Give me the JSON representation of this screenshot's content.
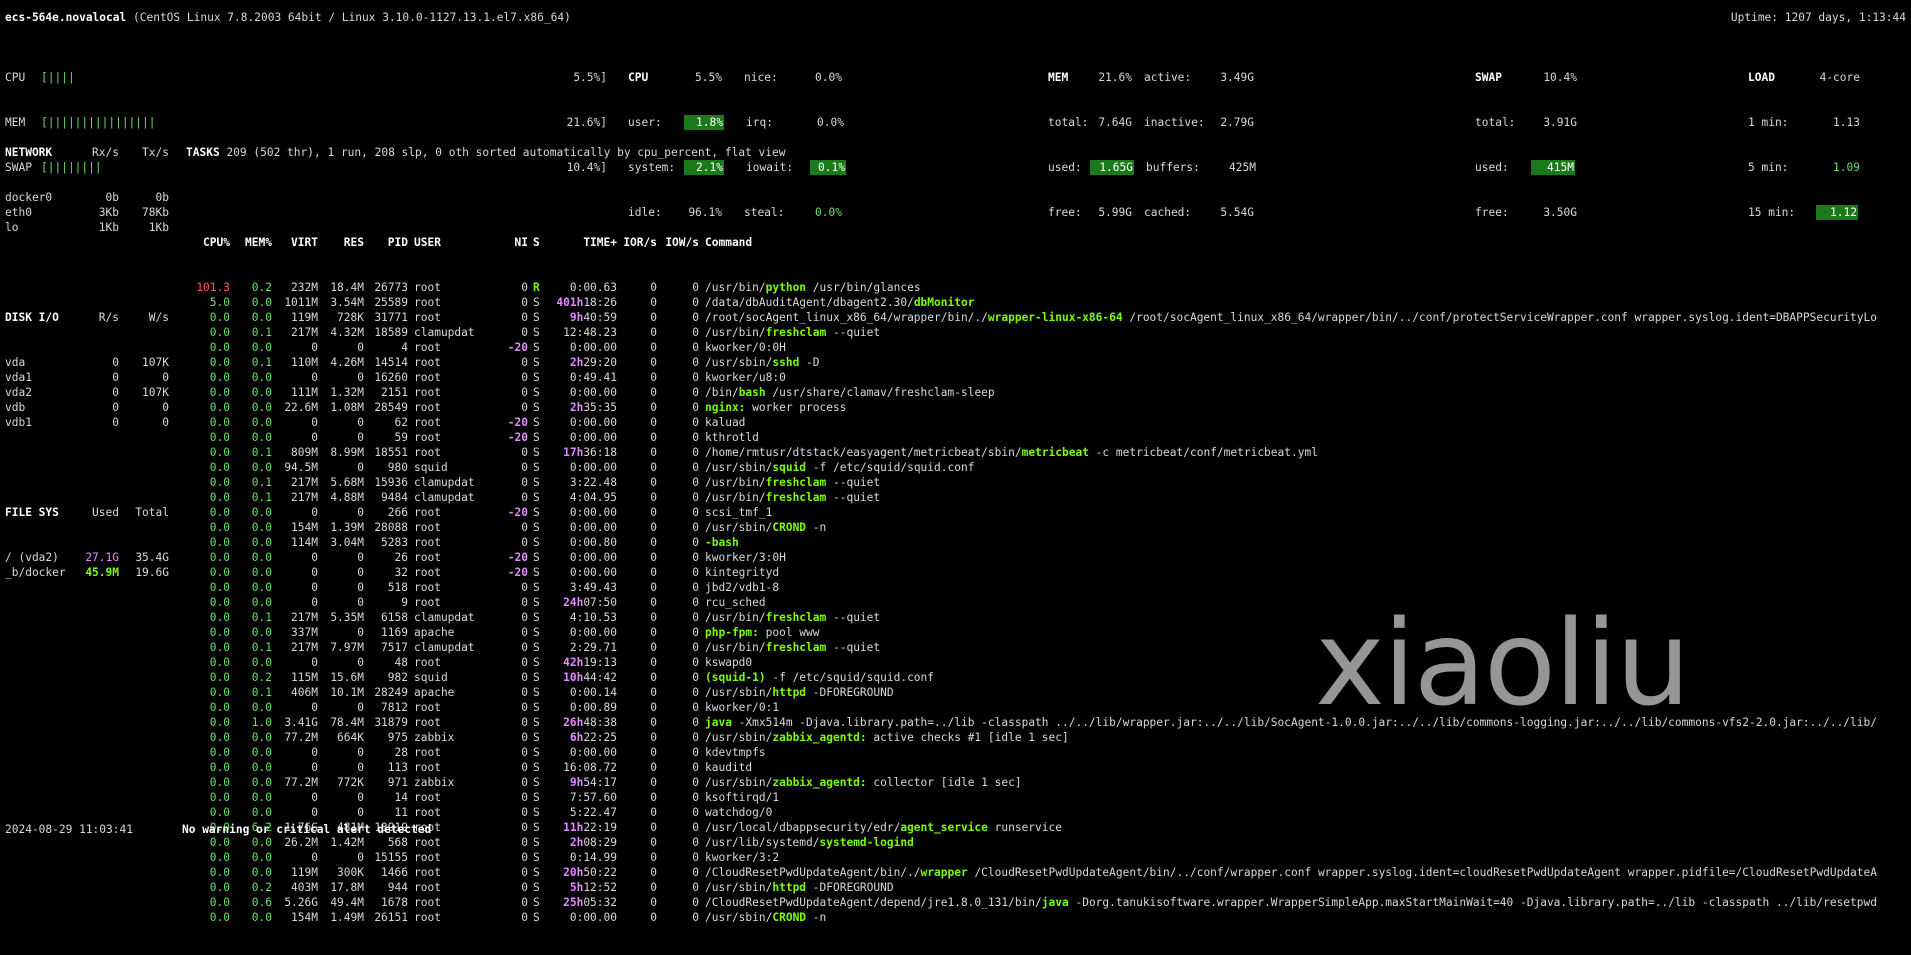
{
  "header": {
    "hostname": "ecs-564e.novalocal",
    "sysinfo": "(CentOS Linux 7.8.2003 64bit / Linux 3.10.0-1127.13.1.el7.x86_64)",
    "uptime": "Uptime: 1207 days, 1:13:44"
  },
  "quicklook": {
    "cpu_label": "CPU",
    "cpu_bar": "[||||",
    "cpu_pct": "5.5%]",
    "mem_label": "MEM",
    "mem_bar": "[||||||||||||||||",
    "mem_pct": "21.6%]",
    "swap_label": "SWAP",
    "swap_bar": "[||||||||",
    "swap_pct": "10.4%]"
  },
  "cpu": {
    "title": "CPU",
    "total": "5.5%",
    "user_label": "user:",
    "user": "1.8%",
    "system_label": "system:",
    "system": "2.1%",
    "idle_label": "idle:",
    "idle": "96.1%",
    "nice_label": "nice:",
    "nice": "0.0%",
    "irq_label": "irq:",
    "irq": "0.0%",
    "iowait_label": "iowait:",
    "iowait": "0.1%",
    "steal_label": "steal:",
    "steal": "0.0%"
  },
  "mem": {
    "title": "MEM",
    "total_pct": "21.6%",
    "total_label": "total:",
    "total": "7.64G",
    "used_label": "used:",
    "used": "1.65G",
    "free_label": "free:",
    "free": "5.99G",
    "active_label": "active:",
    "active": "3.49G",
    "inactive_label": "inactive:",
    "inactive": "2.79G",
    "buffers_label": "buffers:",
    "buffers": "425M",
    "cached_label": "cached:",
    "cached": "5.54G"
  },
  "swap": {
    "title": "SWAP",
    "pct": "10.4%",
    "total_label": "total:",
    "total": "3.91G",
    "used_label": "used:",
    "used": "415M",
    "free_label": "free:",
    "free": "3.50G"
  },
  "load": {
    "title": "LOAD",
    "cores": "4-core",
    "m1_label": "1 min:",
    "m1": "1.13",
    "m5_label": "5 min:",
    "m5": "1.09",
    "m15_label": "15 min:",
    "m15": "1.12"
  },
  "network": {
    "title": "NETWORK",
    "rx": "Rx/s",
    "tx": "Tx/s",
    "rows": [
      {
        "name": "docker0",
        "rx": "0b",
        "tx": "0b"
      },
      {
        "name": "eth0",
        "rx": "3Kb",
        "tx": "78Kb"
      },
      {
        "name": "lo",
        "rx": "1Kb",
        "tx": "1Kb"
      }
    ]
  },
  "diskio": {
    "title": "DISK I/O",
    "r": "R/s",
    "w": "W/s",
    "rows": [
      {
        "name": "vda",
        "r": "0",
        "w": "107K"
      },
      {
        "name": "vda1",
        "r": "0",
        "w": "0"
      },
      {
        "name": "vda2",
        "r": "0",
        "w": "107K"
      },
      {
        "name": "vdb",
        "r": "0",
        "w": "0"
      },
      {
        "name": "vdb1",
        "r": "0",
        "w": "0"
      }
    ]
  },
  "filesys": {
    "title": "FILE SYS",
    "used": "Used",
    "total": "Total",
    "rows": [
      {
        "name": "/ (vda2)",
        "used": "27.1G",
        "total": "35.4G"
      },
      {
        "name": "_b/docker",
        "used": "45.9M",
        "total": "19.6G"
      }
    ]
  },
  "tasks": {
    "label": "TASKS",
    "summary": "209 (502 thr), 1 run, 208 slp, 0 oth sorted automatically by cpu_percent, flat view"
  },
  "columns": [
    "CPU%",
    "MEM%",
    "VIRT",
    "RES",
    "PID",
    "USER",
    "NI",
    "S",
    "TIME+",
    "IOR/s",
    "IOW/s",
    "Command"
  ],
  "processes": [
    {
      "cpu": "101.3",
      "mem": "0.2",
      "virt": "232M",
      "res": "18.4M",
      "pid": "26773",
      "user": "root",
      "ni": "0",
      "s": "R",
      "th": "",
      "t": "0:00.63",
      "ior": "0",
      "iow": "0",
      "pre": "/usr/bin/",
      "prog": "python",
      "args": " /usr/bin/glances"
    },
    {
      "cpu": "5.0",
      "mem": "0.0",
      "virt": "1011M",
      "res": "3.54M",
      "pid": "25589",
      "user": "root",
      "ni": "0",
      "s": "S",
      "th": "401h",
      "t": "18:26",
      "ior": "0",
      "iow": "0",
      "pre": "/data/dbAuditAgent/dbagent2.30/",
      "prog": "dbMonitor",
      "args": ""
    },
    {
      "cpu": "0.0",
      "mem": "0.0",
      "virt": "119M",
      "res": "728K",
      "pid": "31771",
      "user": "root",
      "ni": "0",
      "s": "S",
      "th": "9h",
      "t": "40:59",
      "ior": "0",
      "iow": "0",
      "pre": "/root/socAgent_linux_x86_64/wrapper/bin/./",
      "prog": "wrapper-linux-x86-64",
      "args": " /root/socAgent_linux_x86_64/wrapper/bin/../conf/protectServiceWrapper.conf wrapper.syslog.ident=DBAPPSecurityLo"
    },
    {
      "cpu": "0.0",
      "mem": "0.1",
      "virt": "217M",
      "res": "4.32M",
      "pid": "18589",
      "user": "clamupdat",
      "ni": "0",
      "s": "S",
      "th": "",
      "t": "12:48.23",
      "ior": "0",
      "iow": "0",
      "pre": "/usr/bin/",
      "prog": "freshclam",
      "args": " --quiet"
    },
    {
      "cpu": "0.0",
      "mem": "0.0",
      "virt": "0",
      "res": "0",
      "pid": "4",
      "user": "root",
      "ni": "-20",
      "s": "S",
      "th": "",
      "t": "0:00.00",
      "ior": "0",
      "iow": "0",
      "pre": "kworker/0:0H",
      "prog": "",
      "args": ""
    },
    {
      "cpu": "0.0",
      "mem": "0.1",
      "virt": "110M",
      "res": "4.26M",
      "pid": "14514",
      "user": "root",
      "ni": "0",
      "s": "S",
      "th": "2h",
      "t": "29:20",
      "ior": "0",
      "iow": "0",
      "pre": "/usr/sbin/",
      "prog": "sshd",
      "args": " -D"
    },
    {
      "cpu": "0.0",
      "mem": "0.0",
      "virt": "0",
      "res": "0",
      "pid": "16260",
      "user": "root",
      "ni": "0",
      "s": "S",
      "th": "",
      "t": "0:49.41",
      "ior": "0",
      "iow": "0",
      "pre": "kworker/u8:0",
      "prog": "",
      "args": ""
    },
    {
      "cpu": "0.0",
      "mem": "0.0",
      "virt": "111M",
      "res": "1.32M",
      "pid": "2151",
      "user": "root",
      "ni": "0",
      "s": "S",
      "th": "",
      "t": "0:00.00",
      "ior": "0",
      "iow": "0",
      "pre": "/bin/",
      "prog": "bash",
      "args": " /usr/share/clamav/freshclam-sleep"
    },
    {
      "cpu": "0.0",
      "mem": "0.0",
      "virt": "22.6M",
      "res": "1.08M",
      "pid": "28549",
      "user": "root",
      "ni": "0",
      "s": "S",
      "th": "2h",
      "t": "35:35",
      "ior": "0",
      "iow": "0",
      "pre": "",
      "prog": "nginx:",
      "args": " worker process"
    },
    {
      "cpu": "0.0",
      "mem": "0.0",
      "virt": "0",
      "res": "0",
      "pid": "62",
      "user": "root",
      "ni": "-20",
      "s": "S",
      "th": "",
      "t": "0:00.00",
      "ior": "0",
      "iow": "0",
      "pre": "kaluad",
      "prog": "",
      "args": ""
    },
    {
      "cpu": "0.0",
      "mem": "0.0",
      "virt": "0",
      "res": "0",
      "pid": "59",
      "user": "root",
      "ni": "-20",
      "s": "S",
      "th": "",
      "t": "0:00.00",
      "ior": "0",
      "iow": "0",
      "pre": "kthrotld",
      "prog": "",
      "args": ""
    },
    {
      "cpu": "0.0",
      "mem": "0.1",
      "virt": "809M",
      "res": "8.99M",
      "pid": "18551",
      "user": "root",
      "ni": "0",
      "s": "S",
      "th": "17h",
      "t": "36:18",
      "ior": "0",
      "iow": "0",
      "pre": "/home/rmtusr/dtstack/easyagent/metricbeat/sbin/",
      "prog": "metricbeat",
      "args": " -c metricbeat/conf/metricbeat.yml"
    },
    {
      "cpu": "0.0",
      "mem": "0.0",
      "virt": "94.5M",
      "res": "0",
      "pid": "980",
      "user": "squid",
      "ni": "0",
      "s": "S",
      "th": "",
      "t": "0:00.00",
      "ior": "0",
      "iow": "0",
      "pre": "/usr/sbin/",
      "prog": "squid",
      "args": " -f /etc/squid/squid.conf"
    },
    {
      "cpu": "0.0",
      "mem": "0.1",
      "virt": "217M",
      "res": "5.68M",
      "pid": "15936",
      "user": "clamupdat",
      "ni": "0",
      "s": "S",
      "th": "",
      "t": "3:22.48",
      "ior": "0",
      "iow": "0",
      "pre": "/usr/bin/",
      "prog": "freshclam",
      "args": " --quiet"
    },
    {
      "cpu": "0.0",
      "mem": "0.1",
      "virt": "217M",
      "res": "4.88M",
      "pid": "9484",
      "user": "clamupdat",
      "ni": "0",
      "s": "S",
      "th": "",
      "t": "4:04.95",
      "ior": "0",
      "iow": "0",
      "pre": "/usr/bin/",
      "prog": "freshclam",
      "args": " --quiet"
    },
    {
      "cpu": "0.0",
      "mem": "0.0",
      "virt": "0",
      "res": "0",
      "pid": "266",
      "user": "root",
      "ni": "-20",
      "s": "S",
      "th": "",
      "t": "0:00.00",
      "ior": "0",
      "iow": "0",
      "pre": "scsi_tmf_1",
      "prog": "",
      "args": ""
    },
    {
      "cpu": "0.0",
      "mem": "0.0",
      "virt": "154M",
      "res": "1.39M",
      "pid": "28088",
      "user": "root",
      "ni": "0",
      "s": "S",
      "th": "",
      "t": "0:00.00",
      "ior": "0",
      "iow": "0",
      "pre": "/usr/sbin/",
      "prog": "CROND",
      "args": " -n"
    },
    {
      "cpu": "0.0",
      "mem": "0.0",
      "virt": "114M",
      "res": "3.04M",
      "pid": "5283",
      "user": "root",
      "ni": "0",
      "s": "S",
      "th": "",
      "t": "0:00.80",
      "ior": "0",
      "iow": "0",
      "pre": "",
      "prog": "-bash",
      "args": ""
    },
    {
      "cpu": "0.0",
      "mem": "0.0",
      "virt": "0",
      "res": "0",
      "pid": "26",
      "user": "root",
      "ni": "-20",
      "s": "S",
      "th": "",
      "t": "0:00.00",
      "ior": "0",
      "iow": "0",
      "pre": "kworker/3:0H",
      "prog": "",
      "args": ""
    },
    {
      "cpu": "0.0",
      "mem": "0.0",
      "virt": "0",
      "res": "0",
      "pid": "32",
      "user": "root",
      "ni": "-20",
      "s": "S",
      "th": "",
      "t": "0:00.00",
      "ior": "0",
      "iow": "0",
      "pre": "kintegrityd",
      "prog": "",
      "args": ""
    },
    {
      "cpu": "0.0",
      "mem": "0.0",
      "virt": "0",
      "res": "0",
      "pid": "518",
      "user": "root",
      "ni": "0",
      "s": "S",
      "th": "",
      "t": "3:49.43",
      "ior": "0",
      "iow": "0",
      "pre": "jbd2/vdb1-8",
      "prog": "",
      "args": ""
    },
    {
      "cpu": "0.0",
      "mem": "0.0",
      "virt": "0",
      "res": "0",
      "pid": "9",
      "user": "root",
      "ni": "0",
      "s": "S",
      "th": "24h",
      "t": "07:50",
      "ior": "0",
      "iow": "0",
      "pre": "rcu_sched",
      "prog": "",
      "args": ""
    },
    {
      "cpu": "0.0",
      "mem": "0.1",
      "virt": "217M",
      "res": "5.35M",
      "pid": "6158",
      "user": "clamupdat",
      "ni": "0",
      "s": "S",
      "th": "",
      "t": "4:10.53",
      "ior": "0",
      "iow": "0",
      "pre": "/usr/bin/",
      "prog": "freshclam",
      "args": " --quiet"
    },
    {
      "cpu": "0.0",
      "mem": "0.0",
      "virt": "337M",
      "res": "0",
      "pid": "1169",
      "user": "apache",
      "ni": "0",
      "s": "S",
      "th": "",
      "t": "0:00.00",
      "ior": "0",
      "iow": "0",
      "pre": "",
      "prog": "php-fpm:",
      "args": " pool www"
    },
    {
      "cpu": "0.0",
      "mem": "0.1",
      "virt": "217M",
      "res": "7.97M",
      "pid": "7517",
      "user": "clamupdat",
      "ni": "0",
      "s": "S",
      "th": "",
      "t": "2:29.71",
      "ior": "0",
      "iow": "0",
      "pre": "/usr/bin/",
      "prog": "freshclam",
      "args": " --quiet"
    },
    {
      "cpu": "0.0",
      "mem": "0.0",
      "virt": "0",
      "res": "0",
      "pid": "48",
      "user": "root",
      "ni": "0",
      "s": "S",
      "th": "42h",
      "t": "19:13",
      "ior": "0",
      "iow": "0",
      "pre": "kswapd0",
      "prog": "",
      "args": ""
    },
    {
      "cpu": "0.0",
      "mem": "0.2",
      "virt": "115M",
      "res": "15.6M",
      "pid": "982",
      "user": "squid",
      "ni": "0",
      "s": "S",
      "th": "10h",
      "t": "44:42",
      "ior": "0",
      "iow": "0",
      "pre": "",
      "prog": "(squid-1)",
      "args": " -f /etc/squid/squid.conf"
    },
    {
      "cpu": "0.0",
      "mem": "0.1",
      "virt": "406M",
      "res": "10.1M",
      "pid": "28249",
      "user": "apache",
      "ni": "0",
      "s": "S",
      "th": "",
      "t": "0:00.14",
      "ior": "0",
      "iow": "0",
      "pre": "/usr/sbin/",
      "prog": "httpd",
      "args": " -DFOREGROUND"
    },
    {
      "cpu": "0.0",
      "mem": "0.0",
      "virt": "0",
      "res": "0",
      "pid": "7812",
      "user": "root",
      "ni": "0",
      "s": "S",
      "th": "",
      "t": "0:00.89",
      "ior": "0",
      "iow": "0",
      "pre": "kworker/0:1",
      "prog": "",
      "args": ""
    },
    {
      "cpu": "0.0",
      "mem": "1.0",
      "virt": "3.41G",
      "res": "78.4M",
      "pid": "31879",
      "user": "root",
      "ni": "0",
      "s": "S",
      "th": "26h",
      "t": "48:38",
      "ior": "0",
      "iow": "0",
      "pre": "",
      "prog": "java",
      "args": " -Xmx514m -Djava.library.path=../lib -classpath ../../lib/wrapper.jar:../../lib/SocAgent-1.0.0.jar:../../lib/commons-logging.jar:../../lib/commons-vfs2-2.0.jar:../../lib/"
    },
    {
      "cpu": "0.0",
      "mem": "0.0",
      "virt": "77.2M",
      "res": "664K",
      "pid": "975",
      "user": "zabbix",
      "ni": "0",
      "s": "S",
      "th": "6h",
      "t": "22:25",
      "ior": "0",
      "iow": "0",
      "pre": "/usr/sbin/",
      "prog": "zabbix_agentd:",
      "args": " active checks #1 [idle 1 sec]"
    },
    {
      "cpu": "0.0",
      "mem": "0.0",
      "virt": "0",
      "res": "0",
      "pid": "28",
      "user": "root",
      "ni": "0",
      "s": "S",
      "th": "",
      "t": "0:00.00",
      "ior": "0",
      "iow": "0",
      "pre": "kdevtmpfs",
      "prog": "",
      "args": ""
    },
    {
      "cpu": "0.0",
      "mem": "0.0",
      "virt": "0",
      "res": "0",
      "pid": "113",
      "user": "root",
      "ni": "0",
      "s": "S",
      "th": "",
      "t": "16:08.72",
      "ior": "0",
      "iow": "0",
      "pre": "kauditd",
      "prog": "",
      "args": ""
    },
    {
      "cpu": "0.0",
      "mem": "0.0",
      "virt": "77.2M",
      "res": "772K",
      "pid": "971",
      "user": "zabbix",
      "ni": "0",
      "s": "S",
      "th": "9h",
      "t": "54:17",
      "ior": "0",
      "iow": "0",
      "pre": "/usr/sbin/",
      "prog": "zabbix_agentd:",
      "args": " collector [idle 1 sec]"
    },
    {
      "cpu": "0.0",
      "mem": "0.0",
      "virt": "0",
      "res": "0",
      "pid": "14",
      "user": "root",
      "ni": "0",
      "s": "S",
      "th": "",
      "t": "7:57.60",
      "ior": "0",
      "iow": "0",
      "pre": "ksoftirqd/1",
      "prog": "",
      "args": ""
    },
    {
      "cpu": "0.0",
      "mem": "0.0",
      "virt": "0",
      "res": "0",
      "pid": "11",
      "user": "root",
      "ni": "0",
      "s": "S",
      "th": "",
      "t": "5:22.47",
      "ior": "0",
      "iow": "0",
      "pre": "watchdog/0",
      "prog": "",
      "args": ""
    },
    {
      "cpu": "0.0",
      "mem": "6.2",
      "virt": "1.76G",
      "res": "481M",
      "pid": "13919",
      "user": "root",
      "ni": "0",
      "s": "S",
      "th": "11h",
      "t": "22:19",
      "ior": "0",
      "iow": "0",
      "pre": "/usr/local/dbappsecurity/edr/",
      "prog": "agent_service",
      "args": " runservice"
    },
    {
      "cpu": "0.0",
      "mem": "0.0",
      "virt": "26.2M",
      "res": "1.42M",
      "pid": "568",
      "user": "root",
      "ni": "0",
      "s": "S",
      "th": "2h",
      "t": "08:29",
      "ior": "0",
      "iow": "0",
      "pre": "/usr/lib/systemd/",
      "prog": "systemd-logind",
      "args": ""
    },
    {
      "cpu": "0.0",
      "mem": "0.0",
      "virt": "0",
      "res": "0",
      "pid": "15155",
      "user": "root",
      "ni": "0",
      "s": "S",
      "th": "",
      "t": "0:14.99",
      "ior": "0",
      "iow": "0",
      "pre": "kworker/3:2",
      "prog": "",
      "args": ""
    },
    {
      "cpu": "0.0",
      "mem": "0.0",
      "virt": "119M",
      "res": "300K",
      "pid": "1466",
      "user": "root",
      "ni": "0",
      "s": "S",
      "th": "20h",
      "t": "50:22",
      "ior": "0",
      "iow": "0",
      "pre": "/CloudResetPwdUpdateAgent/bin/./",
      "prog": "wrapper",
      "args": " /CloudResetPwdUpdateAgent/bin/../conf/wrapper.conf wrapper.syslog.ident=cloudResetPwdUpdateAgent wrapper.pidfile=/CloudResetPwdUpdateA"
    },
    {
      "cpu": "0.0",
      "mem": "0.2",
      "virt": "403M",
      "res": "17.8M",
      "pid": "944",
      "user": "root",
      "ni": "0",
      "s": "S",
      "th": "5h",
      "t": "12:52",
      "ior": "0",
      "iow": "0",
      "pre": "/usr/sbin/",
      "prog": "httpd",
      "args": " -DFOREGROUND"
    },
    {
      "cpu": "0.0",
      "mem": "0.6",
      "virt": "5.26G",
      "res": "49.4M",
      "pid": "1678",
      "user": "root",
      "ni": "0",
      "s": "S",
      "th": "25h",
      "t": "05:32",
      "ior": "0",
      "iow": "0",
      "pre": "/CloudResetPwdUpdateAgent/depend/jre1.8.0_131/bin/",
      "prog": "java",
      "args": " -Dorg.tanukisoftware.wrapper.WrapperSimpleApp.maxStartMainWait=40 -Djava.library.path=../lib -classpath ../lib/resetpwd"
    },
    {
      "cpu": "0.0",
      "mem": "0.0",
      "virt": "154M",
      "res": "1.49M",
      "pid": "26151",
      "user": "root",
      "ni": "0",
      "s": "S",
      "th": "",
      "t": "0:00.00",
      "ior": "0",
      "iow": "0",
      "pre": "/usr/sbin/",
      "prog": "CROND",
      "args": " -n"
    }
  ],
  "footer": {
    "datetime": "2024-08-29 11:03:41",
    "alert": "No warning or critical alert detected"
  },
  "watermark": "xiaoliu",
  "colors": {
    "background": "#000000",
    "text": "#d8d8d8",
    "highlight": "#1a7a1a",
    "program": "#7cfc00",
    "critical": "#ff5a5a",
    "time_hours": "#e08cff"
  }
}
